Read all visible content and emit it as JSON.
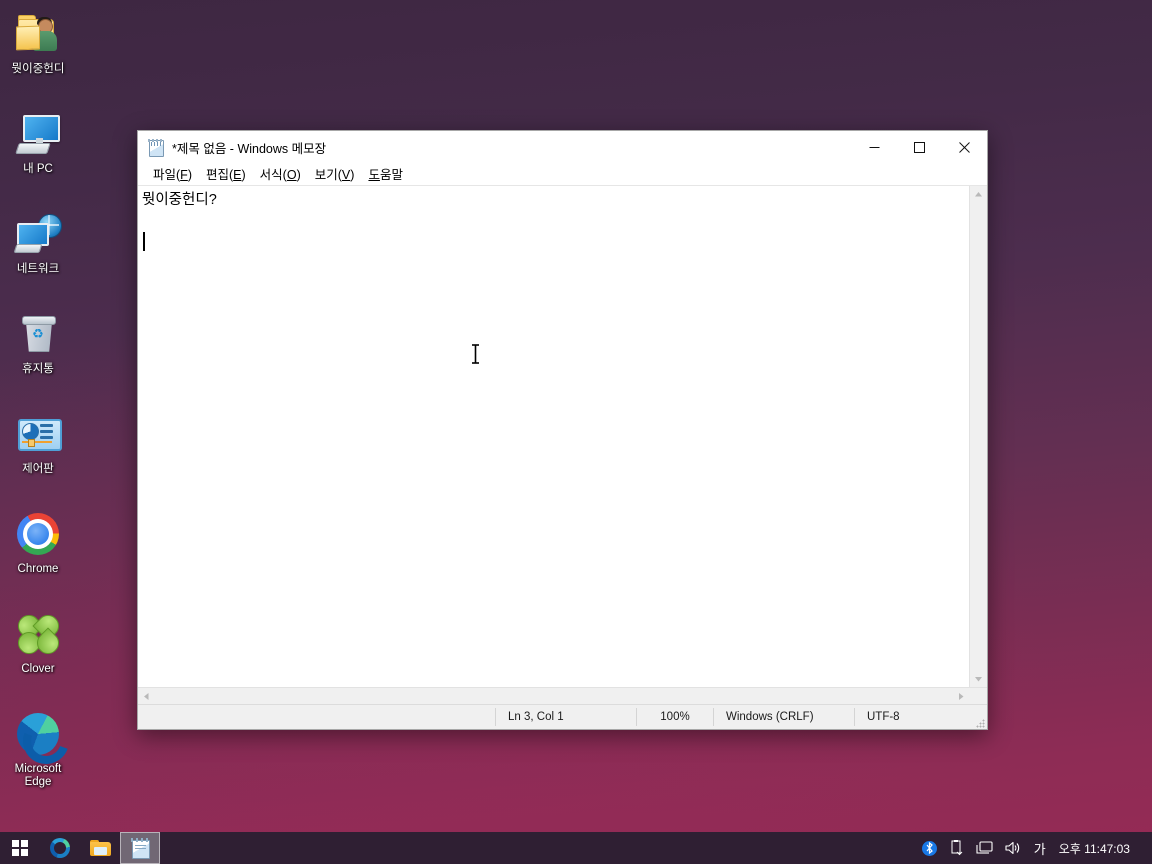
{
  "desktop": {
    "background_top": "#3e2742",
    "background_bottom": "#962a55",
    "icons": [
      {
        "name": "user-folder",
        "label": "뭣이중헌디"
      },
      {
        "name": "my-pc",
        "label": "내 PC"
      },
      {
        "name": "network",
        "label": "네트워크"
      },
      {
        "name": "recycle-bin",
        "label": "휴지통"
      },
      {
        "name": "control-panel",
        "label": "제어판"
      },
      {
        "name": "chrome",
        "label": "Chrome"
      },
      {
        "name": "clover",
        "label": "Clover"
      },
      {
        "name": "edge",
        "label": "Microsoft Edge"
      }
    ]
  },
  "notepad": {
    "title": "*제목 없음 - Windows 메모장",
    "icon": "notepad-icon",
    "window_controls": {
      "minimize": "minimize-icon",
      "maximize": "maximize-icon",
      "close": "close-icon"
    },
    "menu": [
      {
        "name": "file",
        "pre": "파일(",
        "key": "F",
        "post": ")"
      },
      {
        "name": "edit",
        "pre": "편집(",
        "key": "E",
        "post": ")"
      },
      {
        "name": "format",
        "pre": "서식(",
        "key": "O",
        "post": ")"
      },
      {
        "name": "view",
        "pre": "보기(",
        "key": "V",
        "post": ")"
      },
      {
        "name": "help",
        "pre": "",
        "key": "도",
        "post": "움말"
      }
    ],
    "document": {
      "line1": "뭣이중헌디?",
      "line2": "",
      "line3": ""
    },
    "statusbar": {
      "position": "Ln 3, Col 1",
      "zoom": "100%",
      "line_ending": "Windows (CRLF)",
      "encoding": "UTF-8"
    },
    "scrollbars": {
      "up": "scroll-up-icon",
      "down": "scroll-down-icon",
      "left": "scroll-left-icon",
      "right": "scroll-right-icon"
    }
  },
  "taskbar": {
    "background": "#2f1f33",
    "buttons": [
      {
        "name": "start",
        "label": "시작"
      },
      {
        "name": "edge",
        "label": "Microsoft Edge"
      },
      {
        "name": "file-explorer",
        "label": "파일 탐색기"
      },
      {
        "name": "notepad",
        "label": "메모장",
        "active": true
      }
    ],
    "tray": {
      "bluetooth": "bluetooth-icon",
      "usb_eject": "usb-eject-icon",
      "network": "network-icon",
      "volume": "volume-icon",
      "ime": "가",
      "clock": "오후 11:47:03"
    }
  }
}
